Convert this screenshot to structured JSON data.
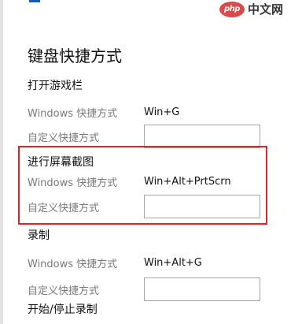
{
  "page_title": "键盘快捷方式",
  "watermark": {
    "logo": "php",
    "text": "中文网"
  },
  "sections": [
    {
      "title": "打开游戏栏",
      "windows_label": "Windows 快捷方式",
      "windows_value": "Win+G",
      "custom_label": "自定义快捷方式",
      "custom_value": ""
    },
    {
      "title": "进行屏幕截图",
      "windows_label": "Windows 快捷方式",
      "windows_value": "Win+Alt+PrtScrn",
      "custom_label": "自定义快捷方式",
      "custom_value": ""
    },
    {
      "title": "录制",
      "windows_label": "Windows 快捷方式",
      "windows_value": "Win+Alt+G",
      "custom_label": "自定义快捷方式",
      "custom_value": ""
    },
    {
      "title": "开始/停止录制"
    }
  ],
  "colors": {
    "highlight": "#e02424",
    "accent": "#1a5aa6",
    "watermark_logo": "#d94b4b"
  }
}
